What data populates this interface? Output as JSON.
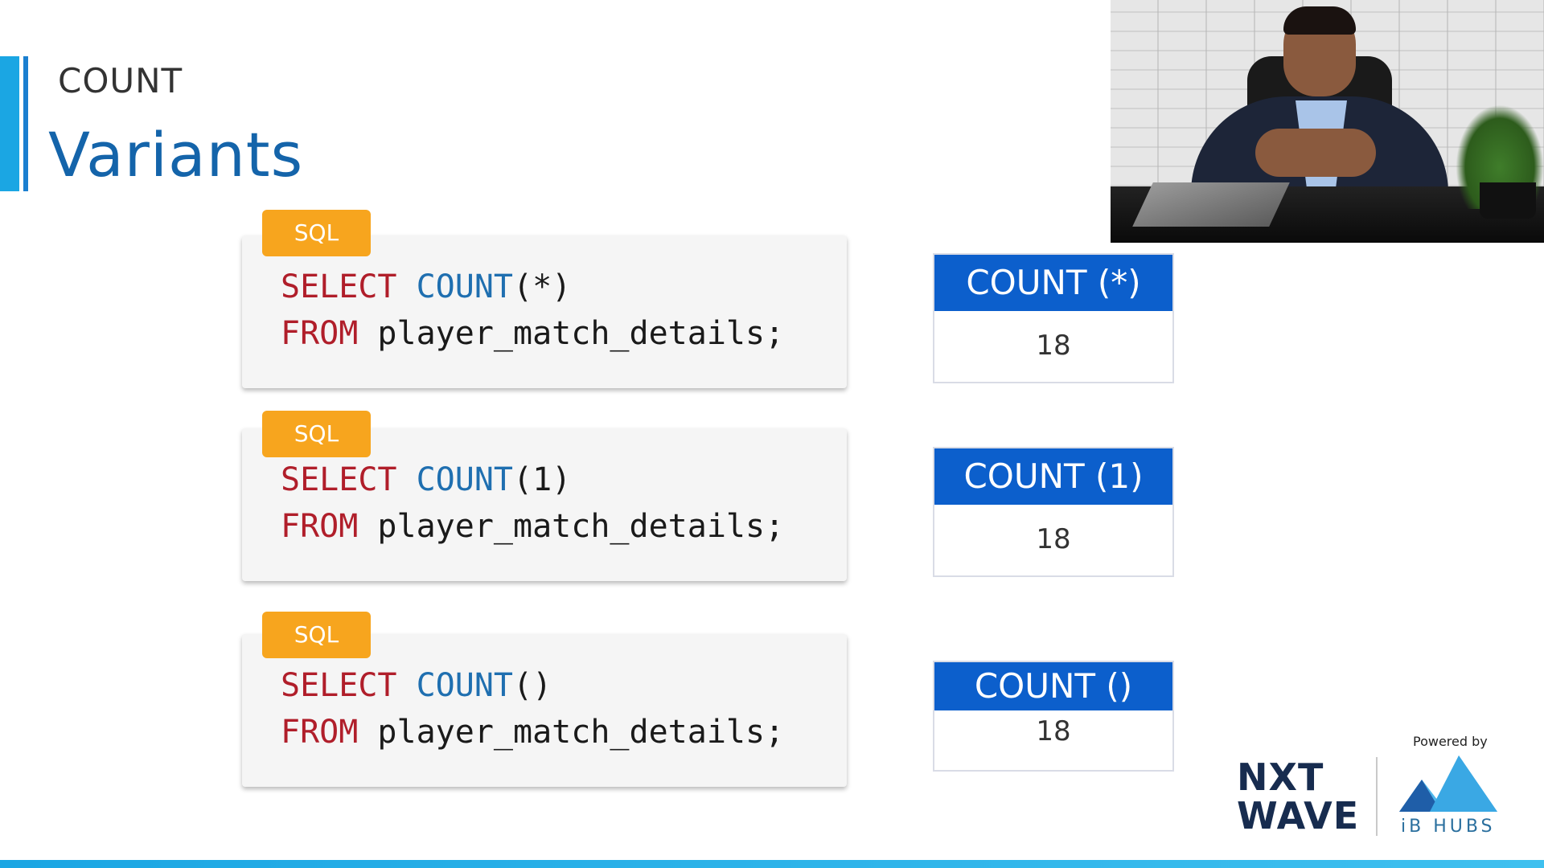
{
  "header": {
    "subtitle": "COUNT",
    "title": "Variants"
  },
  "badge_label": "SQL",
  "queries": [
    {
      "select": "SELECT",
      "fn": "COUNT",
      "arg": "(*)",
      "from": "FROM",
      "table": "player_match_details;"
    },
    {
      "select": "SELECT",
      "fn": "COUNT",
      "arg": "(1)",
      "from": "FROM",
      "table": "player_match_details;"
    },
    {
      "select": "SELECT",
      "fn": "COUNT",
      "arg": "()",
      "from": "FROM",
      "table": "player_match_details;"
    }
  ],
  "results": [
    {
      "header": "COUNT (*)",
      "value": "18"
    },
    {
      "header": "COUNT (1)",
      "value": "18"
    },
    {
      "header": "COUNT ()",
      "value": "18"
    }
  ],
  "branding": {
    "nxt": "NXT",
    "wave": "WAVE",
    "powered_by": "Powered by",
    "ib_hubs": "iB HUBS"
  },
  "colors": {
    "accent": "#1ba6e3",
    "title": "#1464aa",
    "badge": "#f7a51e",
    "result_header": "#0c5fcc",
    "keyword": "#b01e2a",
    "function": "#1f6fb0"
  }
}
